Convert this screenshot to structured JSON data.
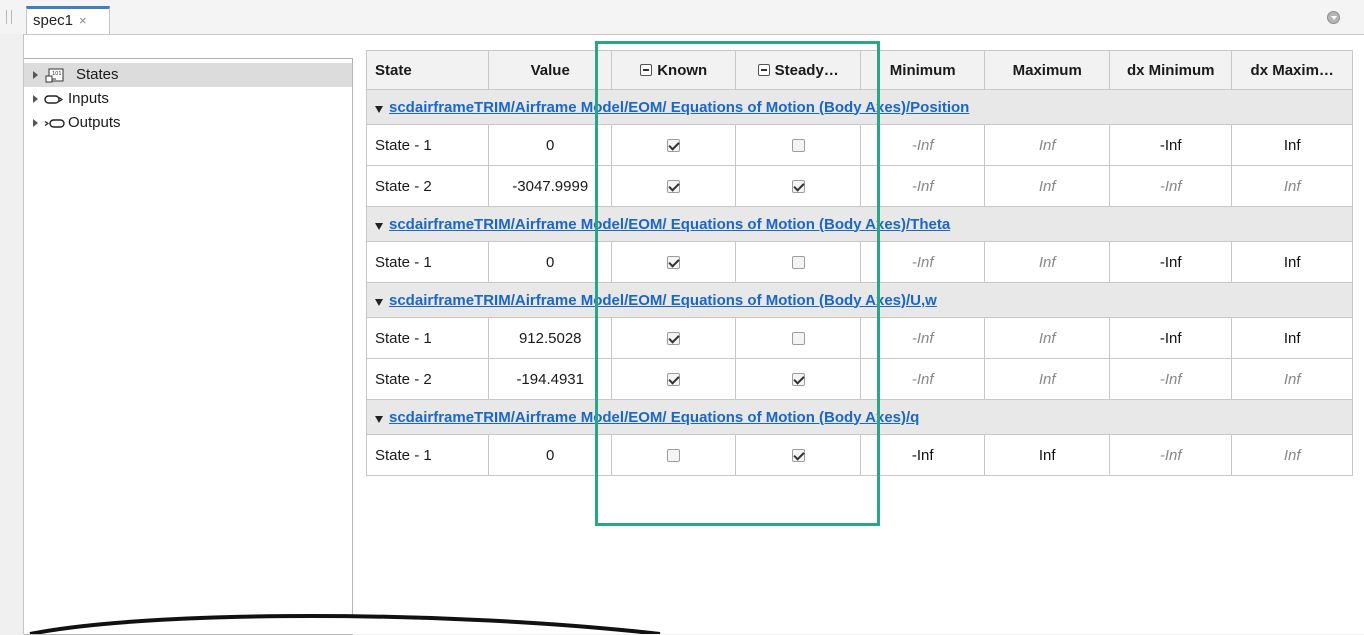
{
  "tabs": [
    {
      "label": "spec1",
      "close": "×"
    }
  ],
  "tree": {
    "items": [
      {
        "label": "States",
        "icon": "states-icon",
        "selected": true
      },
      {
        "label": "Inputs",
        "icon": "inport-icon",
        "selected": false
      },
      {
        "label": "Outputs",
        "icon": "outport-icon",
        "selected": false
      }
    ]
  },
  "table": {
    "headers": {
      "state": "State",
      "value": "Value",
      "known": "Known",
      "steady": "Steady…",
      "minimum": "Minimum",
      "maximum": "Maximum",
      "dx_minimum": "dx Minimum",
      "dx_maximum": "dx Maxim…"
    },
    "groups": [
      {
        "path": "scdairframeTRIM/Airframe Model/EOM/ Equations of Motion (Body Axes)/Position",
        "rows": [
          {
            "state": "State - 1",
            "value": "0",
            "known": true,
            "steady": false,
            "min": "-Inf",
            "max": "Inf",
            "dxmin": "-Inf",
            "dxmax": "Inf"
          },
          {
            "state": "State - 2",
            "value": "-3047.9999",
            "known": true,
            "steady": true,
            "min": "-Inf",
            "max": "Inf",
            "dxmin": "-Inf",
            "dxmax": "Inf"
          }
        ]
      },
      {
        "path": "scdairframeTRIM/Airframe Model/EOM/ Equations of Motion (Body Axes)/Theta",
        "rows": [
          {
            "state": "State - 1",
            "value": "0",
            "known": true,
            "steady": false,
            "min": "-Inf",
            "max": "Inf",
            "dxmin": "-Inf",
            "dxmax": "Inf"
          }
        ]
      },
      {
        "path": "scdairframeTRIM/Airframe Model/EOM/ Equations of Motion (Body Axes)/U,w",
        "rows": [
          {
            "state": "State - 1",
            "value": "912.5028",
            "known": true,
            "steady": false,
            "min": "-Inf",
            "max": "Inf",
            "dxmin": "-Inf",
            "dxmax": "Inf"
          },
          {
            "state": "State - 2",
            "value": "-194.4931",
            "known": true,
            "steady": true,
            "min": "-Inf",
            "max": "Inf",
            "dxmin": "-Inf",
            "dxmax": "Inf"
          }
        ]
      },
      {
        "path": "scdairframeTRIM/Airframe Model/EOM/ Equations of Motion (Body Axes)/q",
        "rows": [
          {
            "state": "State - 1",
            "value": "0",
            "known": false,
            "steady": true,
            "min": "-Inf",
            "max": "Inf",
            "dxmin": "-Inf",
            "dxmax": "Inf"
          }
        ]
      }
    ]
  },
  "colors": {
    "accent": "#3d7fc7",
    "highlight": "#2aa686",
    "link": "#1a66c9"
  }
}
